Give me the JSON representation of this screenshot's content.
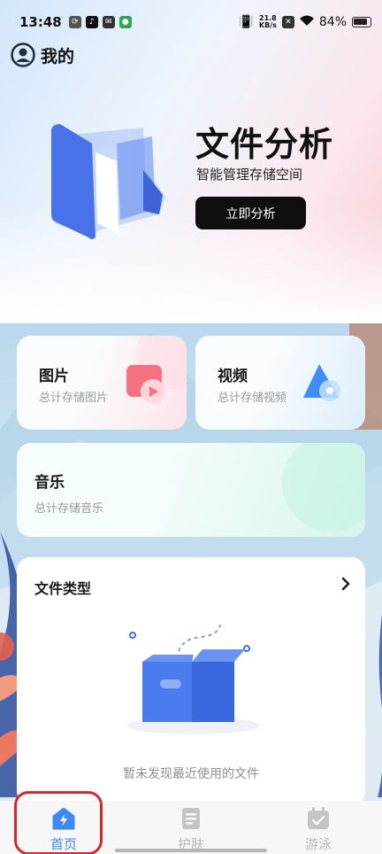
{
  "status_bar": {
    "time": "13:48",
    "net_speed_value": "21.8",
    "net_speed_unit": "KB/s",
    "battery": "84%"
  },
  "header": {
    "title": "我的"
  },
  "hero": {
    "title": "文件分析",
    "subtitle": "智能管理存储空间",
    "button": "立即分析"
  },
  "cards": {
    "pictures": {
      "title": "图片",
      "subtitle": "总计存储图片"
    },
    "videos": {
      "title": "视频",
      "subtitle": "总计存储视频"
    },
    "music": {
      "title": "音乐",
      "subtitle": "总计存储音乐"
    }
  },
  "file_types": {
    "title": "文件类型",
    "empty_text": "暂未发现最近使用的文件"
  },
  "tabbar": {
    "tabs": [
      {
        "label": "首页",
        "icon": "home-bolt-icon",
        "active": true
      },
      {
        "label": "护肤",
        "icon": "document-icon",
        "active": false
      },
      {
        "label": "游泳",
        "icon": "calendar-icon",
        "active": false
      }
    ]
  },
  "colors": {
    "accent": "#3d8af7",
    "highlight": "#d9262b",
    "button_bg": "#0f0f0f"
  }
}
